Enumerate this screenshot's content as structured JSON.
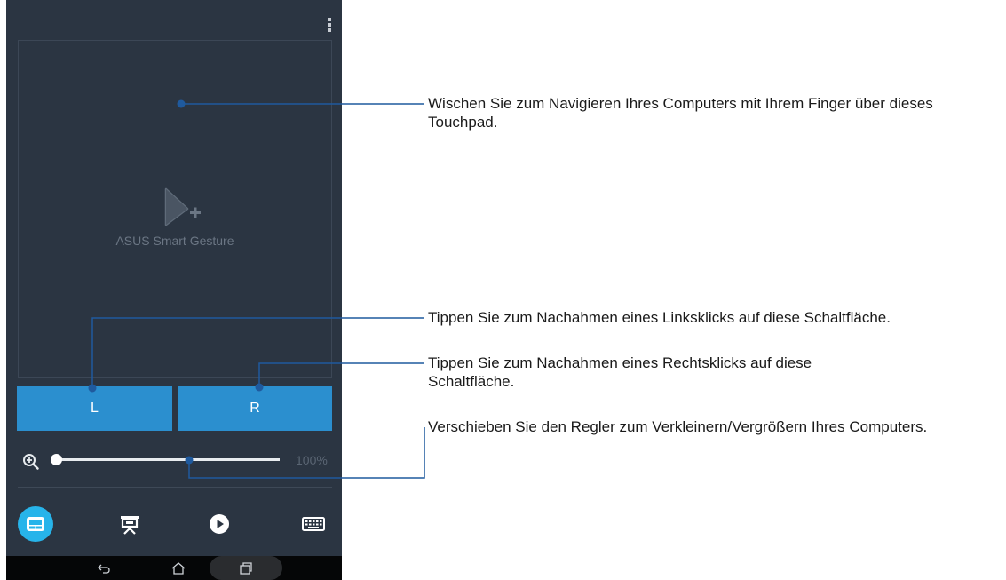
{
  "app": {
    "logo_text": "ASUS Smart Gesture"
  },
  "buttons": {
    "left_label": "L",
    "right_label": "R"
  },
  "zoom": {
    "value_text": "100%",
    "level_fraction": 0.0
  },
  "tabs": [
    {
      "name": "touchpad",
      "icon": "touchpad-icon",
      "active": true
    },
    {
      "name": "presentation",
      "icon": "presentation-icon",
      "active": false
    },
    {
      "name": "media",
      "icon": "play-icon",
      "active": false
    },
    {
      "name": "keyboard",
      "icon": "keyboard-icon",
      "active": false
    }
  ],
  "navbar": {
    "icons": [
      "back-icon",
      "home-icon",
      "recent-apps-icon"
    ]
  },
  "callouts": {
    "touchpad": "Wischen Sie zum Navigieren Ihres Computers mit Ihrem Finger über dieses Touchpad.",
    "left_click": "Tippen Sie zum Nachahmen eines Linksklicks auf diese Schaltfläche.",
    "right_click": "Tippen Sie zum Nachahmen eines Rechtsklicks auf diese Schaltfläche.",
    "zoom": "Verschieben Sie den Regler zum Verkleinern/Vergrößern Ihres Computers."
  },
  "colors": {
    "screen_bg": "#2b3542",
    "button_blue": "#2b8fcf",
    "active_tab": "#27b4ea",
    "callout_line": "#1f5a9e"
  }
}
